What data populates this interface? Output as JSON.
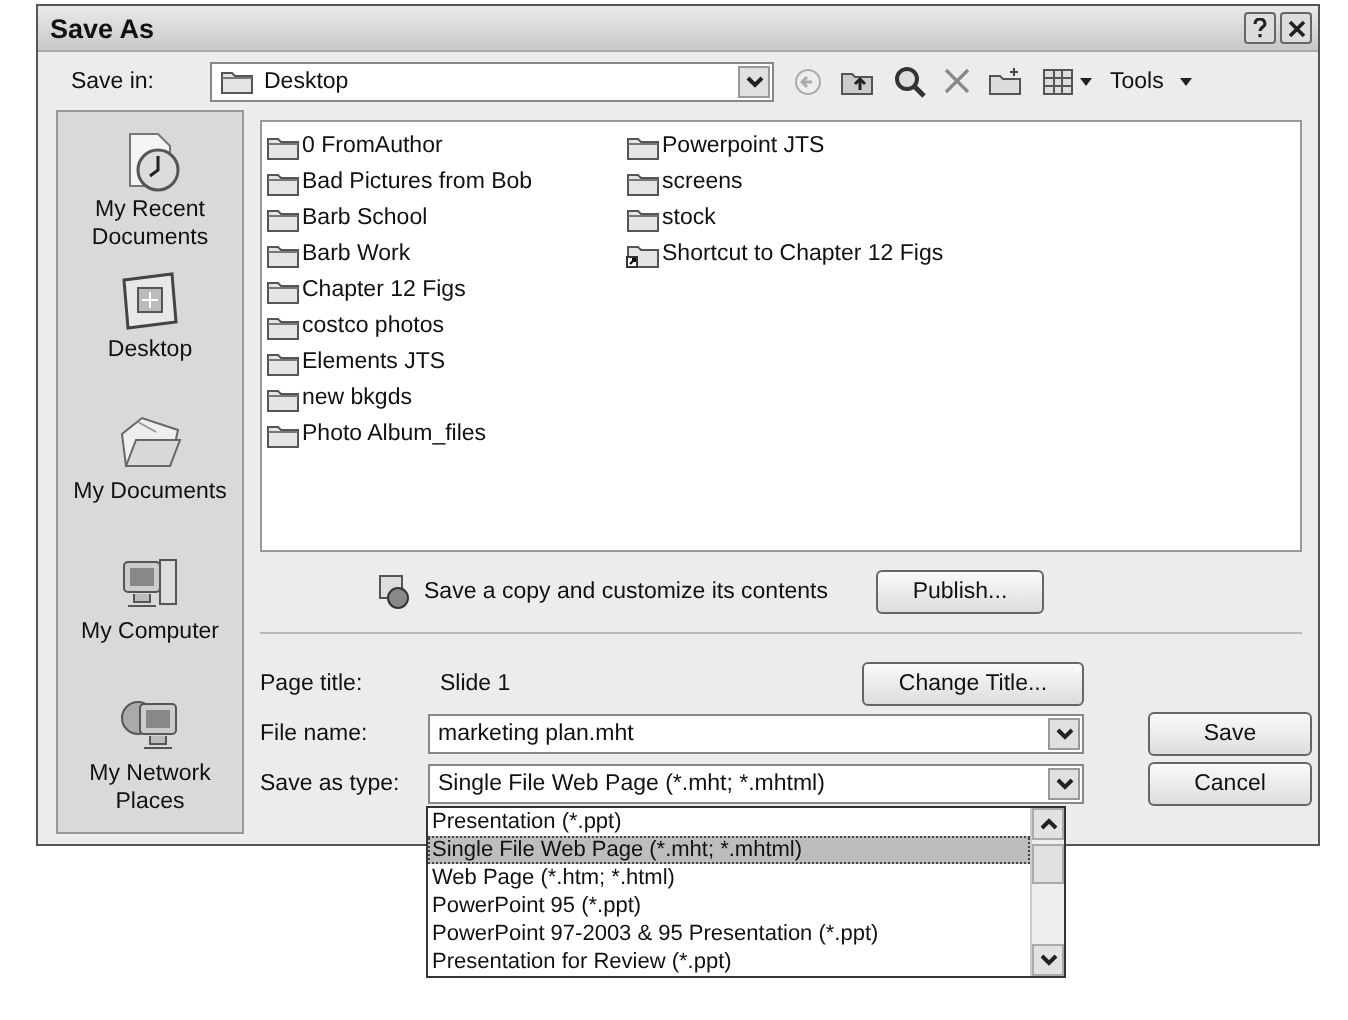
{
  "window": {
    "title": "Save As"
  },
  "save_in": {
    "label": "Save in:",
    "value": "Desktop"
  },
  "toolbar": {
    "tools": "Tools"
  },
  "places": [
    {
      "label": "My Recent Documents",
      "kind": "recent"
    },
    {
      "label": "Desktop",
      "kind": "desktop"
    },
    {
      "label": "My Documents",
      "kind": "documents"
    },
    {
      "label": "My Computer",
      "kind": "computer"
    },
    {
      "label": "My Network Places",
      "kind": "network"
    }
  ],
  "files": [
    {
      "name": "0 FromAuthor",
      "kind": "folder"
    },
    {
      "name": "Bad Pictures from Bob",
      "kind": "folder"
    },
    {
      "name": "Barb School",
      "kind": "folder"
    },
    {
      "name": "Barb Work",
      "kind": "folder"
    },
    {
      "name": "Chapter 12 Figs",
      "kind": "folder"
    },
    {
      "name": "costco photos",
      "kind": "folder"
    },
    {
      "name": "Elements JTS",
      "kind": "folder"
    },
    {
      "name": "new bkgds",
      "kind": "folder"
    },
    {
      "name": "Photo Album_files",
      "kind": "folder"
    },
    {
      "name": "Powerpoint JTS",
      "kind": "folder"
    },
    {
      "name": "screens",
      "kind": "folder"
    },
    {
      "name": "stock",
      "kind": "folder"
    },
    {
      "name": "Shortcut to Chapter 12 Figs",
      "kind": "shortcut"
    }
  ],
  "publish": {
    "text": "Save a copy and customize its contents",
    "button": "Publish..."
  },
  "page_title": {
    "label": "Page title:",
    "value": "Slide 1",
    "button": "Change Title..."
  },
  "file_name": {
    "label": "File name:",
    "value": "marketing plan.mht"
  },
  "save_as_type": {
    "label": "Save as type:",
    "value": "Single File Web Page (*.mht; *.mhtml)",
    "options": [
      {
        "label": "Presentation (*.ppt)",
        "selected": false
      },
      {
        "label": "Single File Web Page (*.mht; *.mhtml)",
        "selected": true
      },
      {
        "label": "Web Page (*.htm; *.html)",
        "selected": false
      },
      {
        "label": "PowerPoint 95 (*.ppt)",
        "selected": false
      },
      {
        "label": "PowerPoint 97-2003 & 95 Presentation (*.ppt)",
        "selected": false
      },
      {
        "label": "Presentation for Review (*.ppt)",
        "selected": false
      }
    ]
  },
  "buttons": {
    "save": "Save",
    "cancel": "Cancel"
  }
}
